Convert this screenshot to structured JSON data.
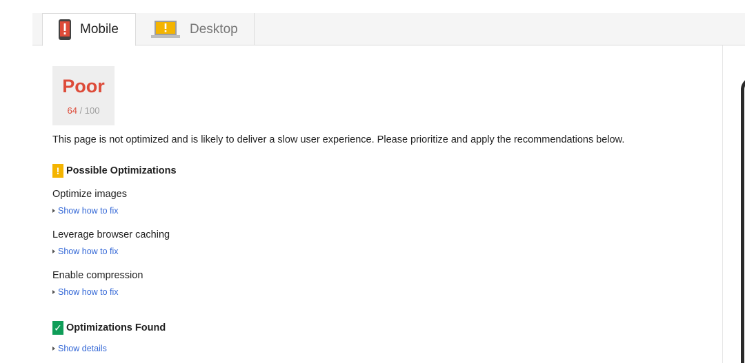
{
  "tabs": {
    "mobile": {
      "label": "Mobile"
    },
    "desktop": {
      "label": "Desktop"
    }
  },
  "score": {
    "rating": "Poor",
    "value": "64",
    "max": "/ 100"
  },
  "summary": "This page is not optimized and is likely to deliver a slow user experience. Please prioritize and apply the recommendations below.",
  "possible_optimizations": {
    "heading": "Possible Optimizations",
    "badge": "!",
    "items": [
      {
        "title": "Optimize images",
        "link": "Show how to fix"
      },
      {
        "title": "Leverage browser caching",
        "link": "Show how to fix"
      },
      {
        "title": "Enable compression",
        "link": "Show how to fix"
      }
    ]
  },
  "optimizations_found": {
    "heading": "Optimizations Found",
    "badge": "✓",
    "link": "Show details"
  },
  "colors": {
    "poor": "#dd4b39",
    "warning": "#f4b400",
    "success": "#0f9d58",
    "link": "#3367d6"
  },
  "icons": {
    "mobile_tab": "phone-warning-icon",
    "desktop_tab": "laptop-warning-icon",
    "warning": "exclamation-icon",
    "success": "checkmark-icon",
    "expand": "triangle-right-icon"
  }
}
